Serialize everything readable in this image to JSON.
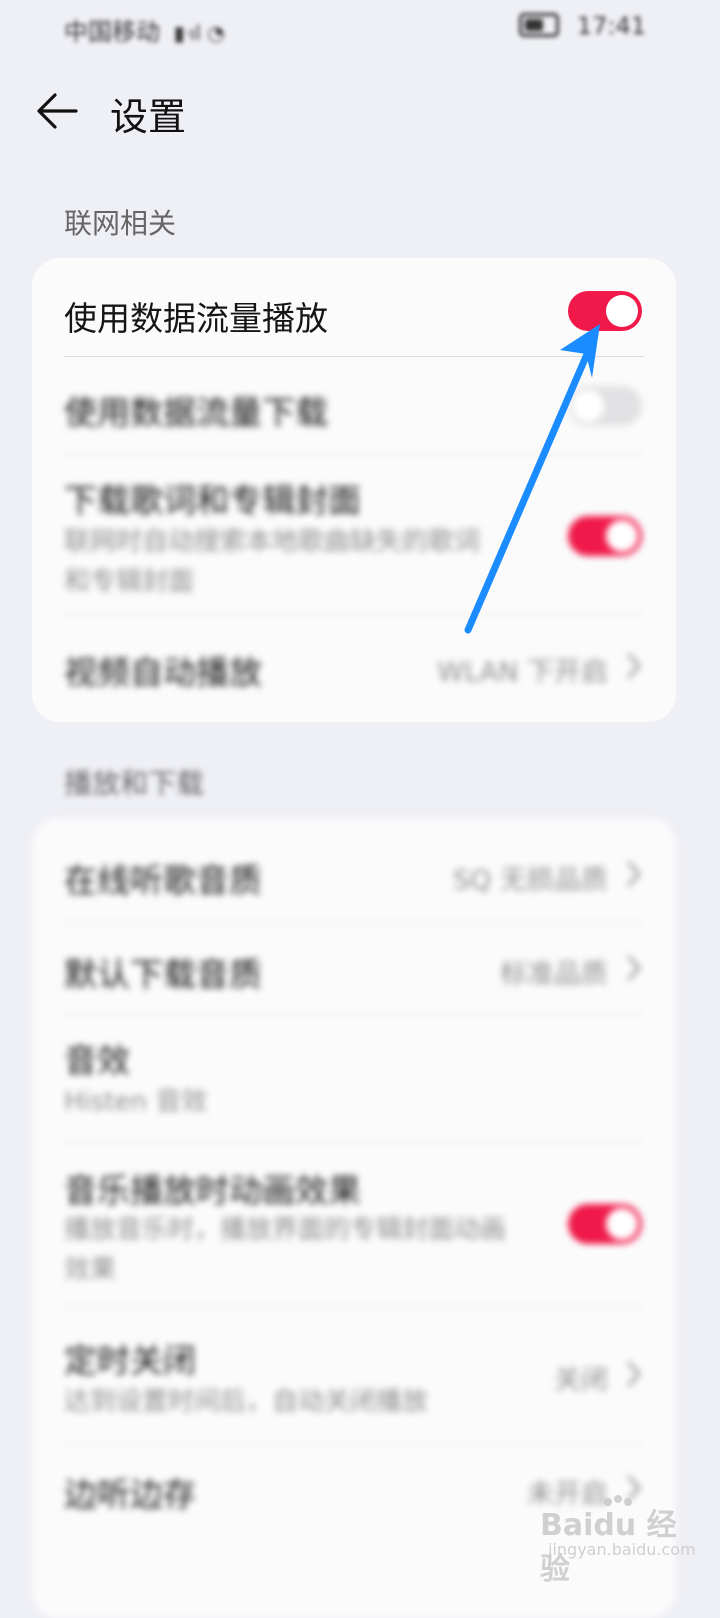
{
  "status_bar": {
    "carrier": "中国移动",
    "time": "17:41"
  },
  "header": {
    "title": "设置"
  },
  "sections": [
    {
      "title": "联网相关",
      "items": [
        {
          "label": "使用数据流量播放",
          "toggle": true
        },
        {
          "label": "使用数据流量下载",
          "toggle": false
        },
        {
          "label": "下载歌词和专辑封面",
          "subtitle": "联网时自动搜索本地歌曲缺失的歌词和专辑封面",
          "toggle": true
        },
        {
          "label": "视频自动播放",
          "value": "WLAN 下开启"
        }
      ]
    },
    {
      "title": "播放和下载",
      "items": [
        {
          "label": "在线听歌音质",
          "value": "SQ 无损品质"
        },
        {
          "label": "默认下载音质",
          "value": "标准品质"
        },
        {
          "label": "音效",
          "subtitle": "Histen 音效"
        },
        {
          "label": "音乐播放时动画效果",
          "subtitle": "播放音乐时，播放界面的专辑封面动画效果",
          "toggle": true
        },
        {
          "label": "定时关闭",
          "subtitle": "达到设置时间后，自动关闭播放",
          "value": "关闭"
        },
        {
          "label": "边听边存",
          "value": "未开启"
        }
      ]
    }
  ],
  "watermark": {
    "main": "Baidu 经验",
    "sub": "jingyan.baidu.com"
  },
  "colors": {
    "toggle_on": "#f0194a",
    "annotation_arrow": "#1a8cff",
    "background": "#eff0f5"
  }
}
